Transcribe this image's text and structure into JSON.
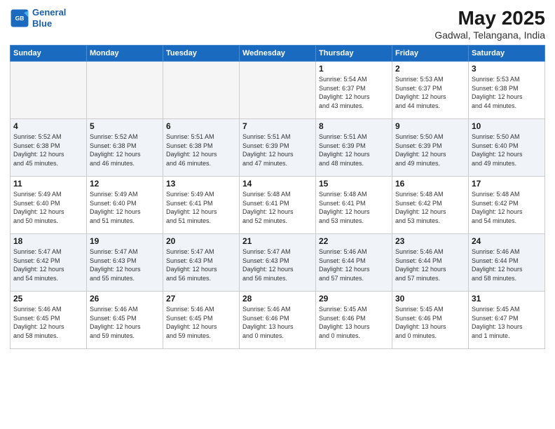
{
  "header": {
    "logo_line1": "General",
    "logo_line2": "Blue",
    "main_title": "May 2025",
    "sub_title": "Gadwal, Telangana, India"
  },
  "days_of_week": [
    "Sunday",
    "Monday",
    "Tuesday",
    "Wednesday",
    "Thursday",
    "Friday",
    "Saturday"
  ],
  "weeks": [
    [
      {
        "day": "",
        "info": ""
      },
      {
        "day": "",
        "info": ""
      },
      {
        "day": "",
        "info": ""
      },
      {
        "day": "",
        "info": ""
      },
      {
        "day": "1",
        "info": "Sunrise: 5:54 AM\nSunset: 6:37 PM\nDaylight: 12 hours\nand 43 minutes."
      },
      {
        "day": "2",
        "info": "Sunrise: 5:53 AM\nSunset: 6:37 PM\nDaylight: 12 hours\nand 44 minutes."
      },
      {
        "day": "3",
        "info": "Sunrise: 5:53 AM\nSunset: 6:38 PM\nDaylight: 12 hours\nand 44 minutes."
      }
    ],
    [
      {
        "day": "4",
        "info": "Sunrise: 5:52 AM\nSunset: 6:38 PM\nDaylight: 12 hours\nand 45 minutes."
      },
      {
        "day": "5",
        "info": "Sunrise: 5:52 AM\nSunset: 6:38 PM\nDaylight: 12 hours\nand 46 minutes."
      },
      {
        "day": "6",
        "info": "Sunrise: 5:51 AM\nSunset: 6:38 PM\nDaylight: 12 hours\nand 46 minutes."
      },
      {
        "day": "7",
        "info": "Sunrise: 5:51 AM\nSunset: 6:39 PM\nDaylight: 12 hours\nand 47 minutes."
      },
      {
        "day": "8",
        "info": "Sunrise: 5:51 AM\nSunset: 6:39 PM\nDaylight: 12 hours\nand 48 minutes."
      },
      {
        "day": "9",
        "info": "Sunrise: 5:50 AM\nSunset: 6:39 PM\nDaylight: 12 hours\nand 49 minutes."
      },
      {
        "day": "10",
        "info": "Sunrise: 5:50 AM\nSunset: 6:40 PM\nDaylight: 12 hours\nand 49 minutes."
      }
    ],
    [
      {
        "day": "11",
        "info": "Sunrise: 5:49 AM\nSunset: 6:40 PM\nDaylight: 12 hours\nand 50 minutes."
      },
      {
        "day": "12",
        "info": "Sunrise: 5:49 AM\nSunset: 6:40 PM\nDaylight: 12 hours\nand 51 minutes."
      },
      {
        "day": "13",
        "info": "Sunrise: 5:49 AM\nSunset: 6:41 PM\nDaylight: 12 hours\nand 51 minutes."
      },
      {
        "day": "14",
        "info": "Sunrise: 5:48 AM\nSunset: 6:41 PM\nDaylight: 12 hours\nand 52 minutes."
      },
      {
        "day": "15",
        "info": "Sunrise: 5:48 AM\nSunset: 6:41 PM\nDaylight: 12 hours\nand 53 minutes."
      },
      {
        "day": "16",
        "info": "Sunrise: 5:48 AM\nSunset: 6:42 PM\nDaylight: 12 hours\nand 53 minutes."
      },
      {
        "day": "17",
        "info": "Sunrise: 5:48 AM\nSunset: 6:42 PM\nDaylight: 12 hours\nand 54 minutes."
      }
    ],
    [
      {
        "day": "18",
        "info": "Sunrise: 5:47 AM\nSunset: 6:42 PM\nDaylight: 12 hours\nand 54 minutes."
      },
      {
        "day": "19",
        "info": "Sunrise: 5:47 AM\nSunset: 6:43 PM\nDaylight: 12 hours\nand 55 minutes."
      },
      {
        "day": "20",
        "info": "Sunrise: 5:47 AM\nSunset: 6:43 PM\nDaylight: 12 hours\nand 56 minutes."
      },
      {
        "day": "21",
        "info": "Sunrise: 5:47 AM\nSunset: 6:43 PM\nDaylight: 12 hours\nand 56 minutes."
      },
      {
        "day": "22",
        "info": "Sunrise: 5:46 AM\nSunset: 6:44 PM\nDaylight: 12 hours\nand 57 minutes."
      },
      {
        "day": "23",
        "info": "Sunrise: 5:46 AM\nSunset: 6:44 PM\nDaylight: 12 hours\nand 57 minutes."
      },
      {
        "day": "24",
        "info": "Sunrise: 5:46 AM\nSunset: 6:44 PM\nDaylight: 12 hours\nand 58 minutes."
      }
    ],
    [
      {
        "day": "25",
        "info": "Sunrise: 5:46 AM\nSunset: 6:45 PM\nDaylight: 12 hours\nand 58 minutes."
      },
      {
        "day": "26",
        "info": "Sunrise: 5:46 AM\nSunset: 6:45 PM\nDaylight: 12 hours\nand 59 minutes."
      },
      {
        "day": "27",
        "info": "Sunrise: 5:46 AM\nSunset: 6:45 PM\nDaylight: 12 hours\nand 59 minutes."
      },
      {
        "day": "28",
        "info": "Sunrise: 5:46 AM\nSunset: 6:46 PM\nDaylight: 13 hours\nand 0 minutes."
      },
      {
        "day": "29",
        "info": "Sunrise: 5:45 AM\nSunset: 6:46 PM\nDaylight: 13 hours\nand 0 minutes."
      },
      {
        "day": "30",
        "info": "Sunrise: 5:45 AM\nSunset: 6:46 PM\nDaylight: 13 hours\nand 0 minutes."
      },
      {
        "day": "31",
        "info": "Sunrise: 5:45 AM\nSunset: 6:47 PM\nDaylight: 13 hours\nand 1 minute."
      }
    ]
  ]
}
